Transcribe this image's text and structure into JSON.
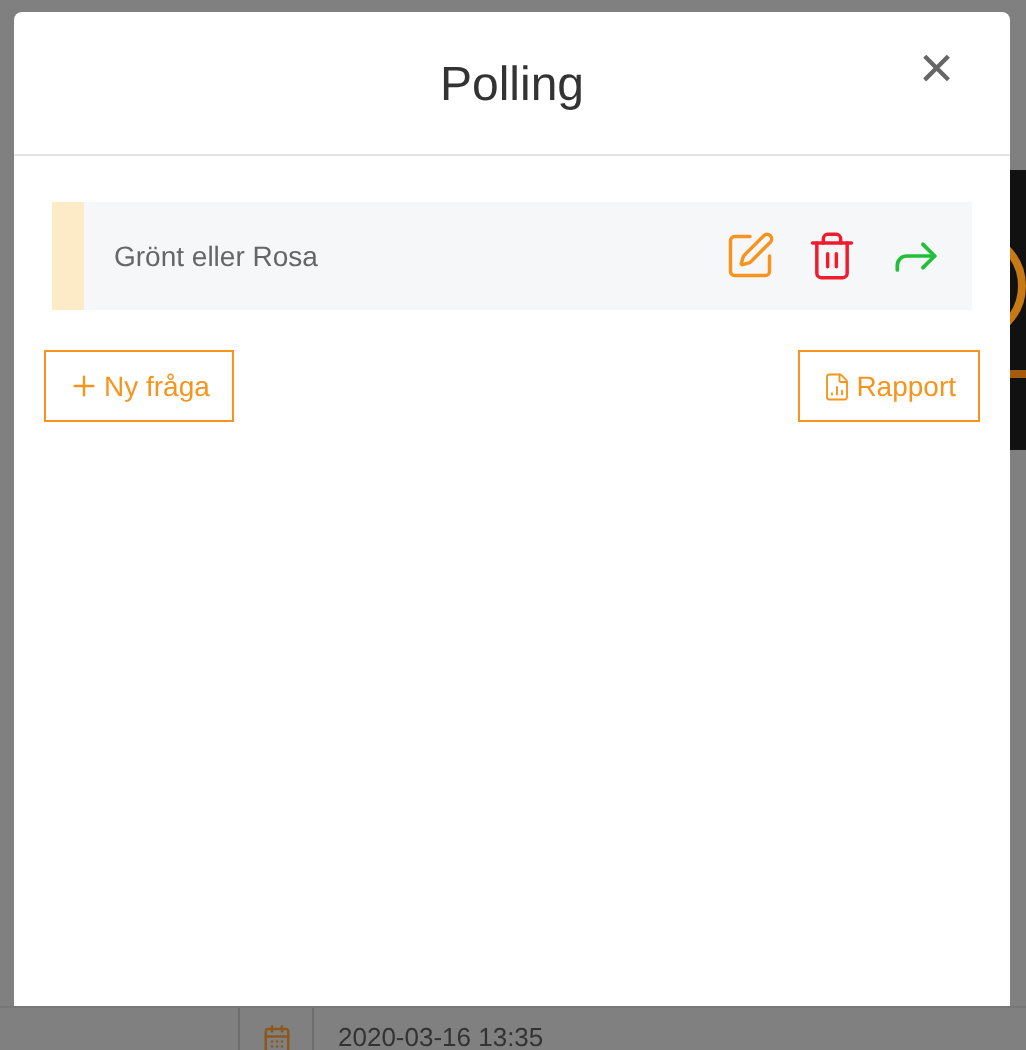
{
  "background": {
    "date": "2020-03-16 13:35"
  },
  "modal": {
    "title": "Polling",
    "close": "×",
    "questions": [
      {
        "text": "Grönt eller Rosa",
        "actions": [
          {
            "kind": "edit"
          },
          {
            "kind": "delete"
          },
          {
            "kind": "share"
          }
        ]
      }
    ],
    "buttons": [
      {
        "kind": "add",
        "label": "Ny fråga"
      },
      {
        "kind": "report",
        "label": "Rapport"
      }
    ]
  }
}
